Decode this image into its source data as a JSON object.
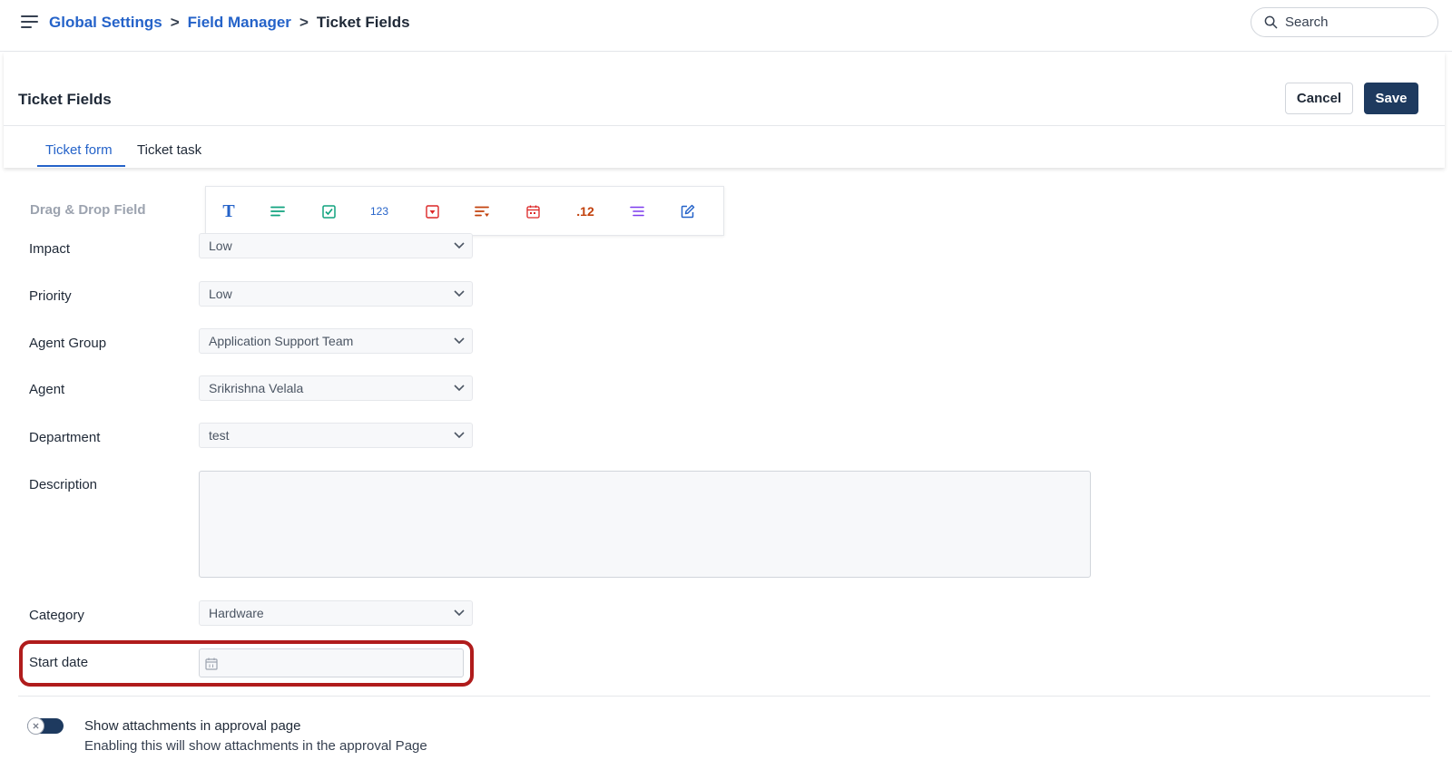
{
  "breadcrumb": {
    "items": [
      "Global Settings",
      "Field Manager"
    ],
    "separator": ">",
    "current": "Ticket Fields"
  },
  "search": {
    "placeholder": "Search"
  },
  "header": {
    "title": "Ticket Fields",
    "cancel_label": "Cancel",
    "save_label": "Save"
  },
  "tabs": [
    {
      "label": "Ticket form",
      "active": true
    },
    {
      "label": "Ticket task",
      "active": false
    }
  ],
  "toolbar": {
    "label": "Drag & Drop Field",
    "tools": [
      {
        "icon": "text-field-icon",
        "glyph": "T",
        "color": "#2563c9"
      },
      {
        "icon": "paragraph-icon",
        "color": "#10a37f"
      },
      {
        "icon": "checkbox-icon",
        "color": "#10a37f"
      },
      {
        "icon": "number-icon",
        "glyph": "123",
        "color": "#2563c9"
      },
      {
        "icon": "dropdown-icon",
        "color": "#dc2626"
      },
      {
        "icon": "multi-select-icon",
        "color": "#c2410c"
      },
      {
        "icon": "date-icon",
        "color": "#dc2626"
      },
      {
        "icon": "decimal-icon",
        "glyph": ".12",
        "color": "#c2410c"
      },
      {
        "icon": "list-icon",
        "color": "#7c3aed"
      },
      {
        "icon": "edit-icon",
        "color": "#2563c9"
      }
    ]
  },
  "form": {
    "fields": [
      {
        "label": "Impact",
        "value": "Low"
      },
      {
        "label": "Priority",
        "value": "Low"
      },
      {
        "label": "Agent Group",
        "value": "Application Support Team"
      },
      {
        "label": "Agent",
        "value": "Srikrishna Velala"
      },
      {
        "label": "Department",
        "value": "test"
      }
    ],
    "description_label": "Description",
    "category": {
      "label": "Category",
      "value": "Hardware"
    },
    "start_date": {
      "label": "Start date"
    }
  },
  "setting": {
    "title": "Show attachments in approval page",
    "description": "Enabling this will show attachments in the approval Page",
    "enabled": false
  },
  "colors": {
    "accent": "#2563c9",
    "primary_button": "#1e3a5f",
    "highlight": "#b01c1c"
  }
}
